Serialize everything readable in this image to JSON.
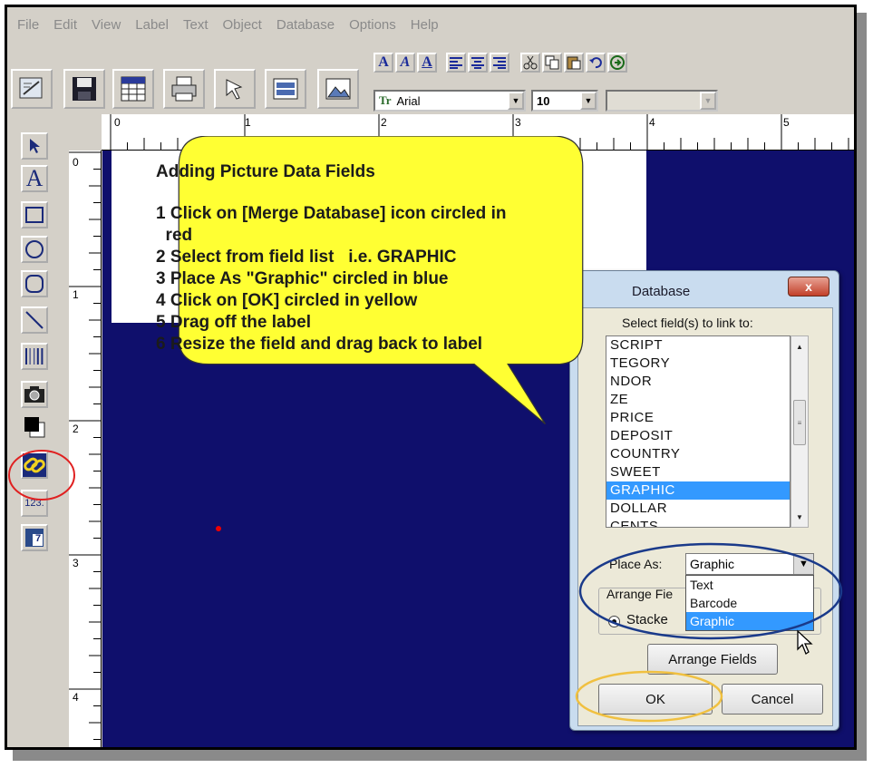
{
  "menu": [
    "File",
    "Edit",
    "View",
    "Label",
    "Text",
    "Object",
    "Database",
    "Options",
    "Help"
  ],
  "toolbar": {
    "format_buttons": [
      "A",
      "A",
      "A"
    ],
    "font_name": "Arial",
    "font_size": "10",
    "font_icon_text": "Tr"
  },
  "ruler": {
    "h_marks": [
      "0",
      "1",
      "2",
      "3",
      "4",
      "5"
    ],
    "v_marks": [
      "0",
      "1",
      "2",
      "3",
      "4"
    ]
  },
  "tools": {
    "text_tool": "A",
    "numbering_tool": "123.",
    "page_tool": "7"
  },
  "callout": {
    "title": "Adding Picture Data Fields",
    "steps": [
      "1 Click on [Merge Database] icon circled in",
      "  red",
      "2 Select from field list   i.e. GRAPHIC",
      "3 Place As \"Graphic\" circled in blue",
      "4 Click on [OK] circled in yellow",
      "5 Drag off the label",
      "6 Resize the field and drag back to label"
    ]
  },
  "dialog": {
    "title": "Database",
    "close_label": "x",
    "instruction": "Select field(s) to link to:",
    "fields": [
      "SCRIPT",
      "TEGORY",
      "NDOR",
      "ZE",
      "PRICE",
      "DEPOSIT",
      "COUNTRY",
      "SWEET",
      "GRAPHIC",
      "DOLLAR",
      "CENTS"
    ],
    "selected_field": "GRAPHIC",
    "place_as_label": "Place As:",
    "place_as_value": "Graphic",
    "place_as_options": [
      "Text",
      "Barcode",
      "Graphic"
    ],
    "arrange_label": "Arrange Fie",
    "stacked_label": "Stacke",
    "arrange_button": "Arrange Fields",
    "ok_button": "OK",
    "cancel_button": "Cancel"
  },
  "colors": {
    "canvas": "#0f0f6c",
    "callout_fill": "#ffff33",
    "highlight_red": "#e02020",
    "highlight_blue": "#1a3a8a",
    "highlight_yellow": "#f0c040",
    "selection": "#3399ff"
  }
}
